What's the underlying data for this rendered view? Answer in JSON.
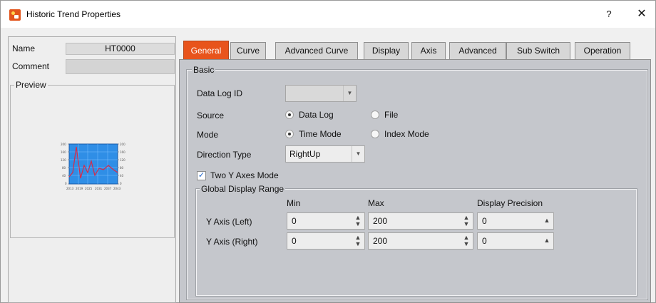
{
  "window": {
    "title": "Historic Trend Properties",
    "help_label": "?",
    "close_label": "✕",
    "app_icon": "app-orange-icon"
  },
  "left": {
    "name_label": "Name",
    "name_value": "HT0000",
    "comment_label": "Comment",
    "comment_value": "",
    "preview_label": "Preview"
  },
  "tabs": [
    {
      "label": "General",
      "active": true
    },
    {
      "label": "Curve"
    },
    {
      "label": "Advanced Curve"
    },
    {
      "label": "Display"
    },
    {
      "label": "Axis"
    },
    {
      "label": "Advanced"
    },
    {
      "label": "Sub Switch"
    },
    {
      "label": "Operation"
    }
  ],
  "basic": {
    "group_label": "Basic",
    "data_log_id": {
      "label": "Data Log ID",
      "value": ""
    },
    "source": {
      "label": "Source",
      "option1": "Data Log",
      "option2": "File",
      "selected": "Data Log"
    },
    "mode": {
      "label": "Mode",
      "option1": "Time Mode",
      "option2": "Index Mode",
      "selected": "Time Mode"
    },
    "direction": {
      "label": "Direction Type",
      "value": "RightUp"
    },
    "two_axes": {
      "label": "Two Y Axes Mode",
      "checked": true
    }
  },
  "range": {
    "group_label": "Global Display Range",
    "col_min": "Min",
    "col_max": "Max",
    "col_precision": "Display Precision",
    "rows": [
      {
        "label": "Y Axis (Left)",
        "min": "0",
        "max": "200",
        "precision": "0"
      },
      {
        "label": "Y Axis (Right)",
        "min": "0",
        "max": "200",
        "precision": "0"
      }
    ]
  },
  "colors": {
    "accent": "#e8541c",
    "panel": "#c5c7cc",
    "chart_bg": "#2f8ee6",
    "curve": "#d62a4a"
  }
}
